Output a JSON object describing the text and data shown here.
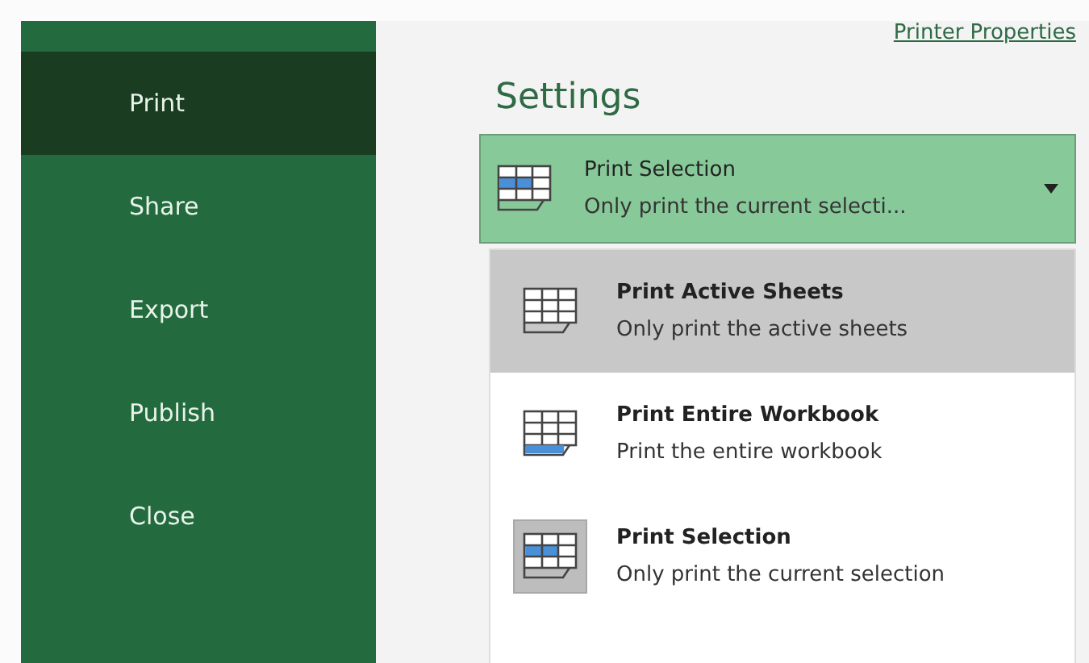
{
  "sidebar": {
    "items": [
      {
        "label": "Print",
        "selected": true
      },
      {
        "label": "Share",
        "selected": false
      },
      {
        "label": "Export",
        "selected": false
      },
      {
        "label": "Publish",
        "selected": false
      },
      {
        "label": "Close",
        "selected": false
      }
    ]
  },
  "printer_properties_link": "Printer Properties",
  "settings": {
    "title": "Settings",
    "dropdown": {
      "kind": "selection",
      "title": "Print Selection",
      "description": "Only print the current selecti...",
      "expanded": true
    },
    "options": [
      {
        "kind": "sheets",
        "title": "Print Active Sheets",
        "description": "Only print the active sheets",
        "hovered": true,
        "selected": false
      },
      {
        "kind": "workbook",
        "title": "Print Entire Workbook",
        "description": "Print the entire workbook",
        "hovered": false,
        "selected": false
      },
      {
        "kind": "selection",
        "title": "Print Selection",
        "description": "Only print the current selection",
        "hovered": false,
        "selected": true
      }
    ]
  }
}
